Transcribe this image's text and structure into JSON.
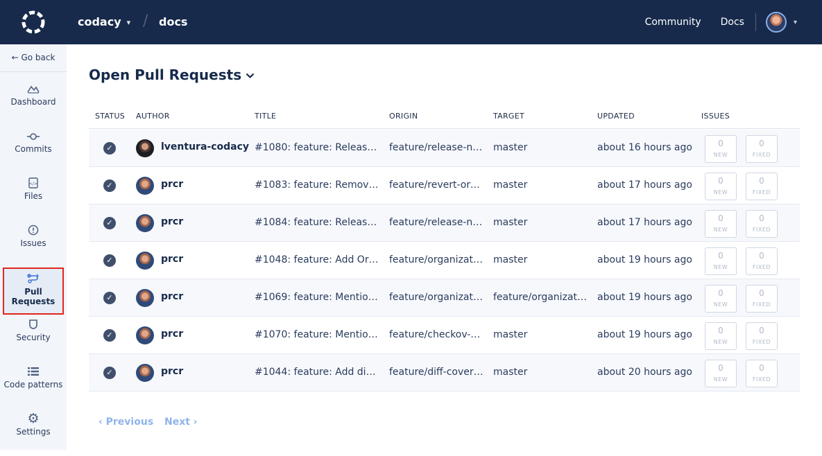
{
  "topbar": {
    "org": "codacy",
    "repo": "docs",
    "links": [
      "Community",
      "Docs"
    ]
  },
  "sidebar": {
    "go_back": "← Go back",
    "items": [
      {
        "label": "Dashboard",
        "icon": "dashboard-icon"
      },
      {
        "label": "Commits",
        "icon": "commit-icon"
      },
      {
        "label": "Files",
        "icon": "file-icon"
      },
      {
        "label": "Issues",
        "icon": "issues-icon"
      },
      {
        "label": "Pull Requests",
        "icon": "pull-request-icon",
        "active": true
      },
      {
        "label": "Security",
        "icon": "shield-icon"
      },
      {
        "label": "Code patterns",
        "icon": "list-icon"
      },
      {
        "label": "Settings",
        "icon": "gear-icon"
      }
    ]
  },
  "main": {
    "title": "Open Pull Requests",
    "columns": [
      "STATUS",
      "AUTHOR",
      "TITLE",
      "ORIGIN",
      "TARGET",
      "UPDATED",
      "ISSUES"
    ],
    "rows": [
      {
        "author": "lventura-codacy",
        "title": "#1080: feature: Release n...",
        "origin": "feature/release-no...",
        "target": "master",
        "updated": "about 16 hours ago",
        "new": "0",
        "fixed": "0"
      },
      {
        "author": "prcr",
        "title": "#1083: feature: Remove li...",
        "origin": "feature/revert-org...",
        "target": "master",
        "updated": "about 17 hours ago",
        "new": "0",
        "fixed": "0"
      },
      {
        "author": "prcr",
        "title": "#1084: feature: Release n...",
        "origin": "feature/release-no...",
        "target": "master",
        "updated": "about 17 hours ago",
        "new": "0",
        "fixed": "0"
      },
      {
        "author": "prcr",
        "title": "#1048: feature: Add Orga...",
        "origin": "feature/organizati...",
        "target": "master",
        "updated": "about 19 hours ago",
        "new": "0",
        "fixed": "0"
      },
      {
        "author": "prcr",
        "title": "#1069: feature: Mention ...",
        "origin": "feature/organizati...",
        "target": "feature/organizati...",
        "updated": "about 19 hours ago",
        "new": "0",
        "fixed": "0"
      },
      {
        "author": "prcr",
        "title": "#1070: feature: Mention t...",
        "origin": "feature/checkov-h...",
        "target": "master",
        "updated": "about 19 hours ago",
        "new": "0",
        "fixed": "0"
      },
      {
        "author": "prcr",
        "title": "#1044: feature: Add diff c...",
        "origin": "feature/diff-covera...",
        "target": "master",
        "updated": "about 20 hours ago",
        "new": "0",
        "fixed": "0"
      }
    ],
    "badge_labels": {
      "new": "NEW",
      "fixed": "FIXED"
    }
  },
  "pagination": {
    "previous": "‹ Previous",
    "next": "Next ›"
  }
}
